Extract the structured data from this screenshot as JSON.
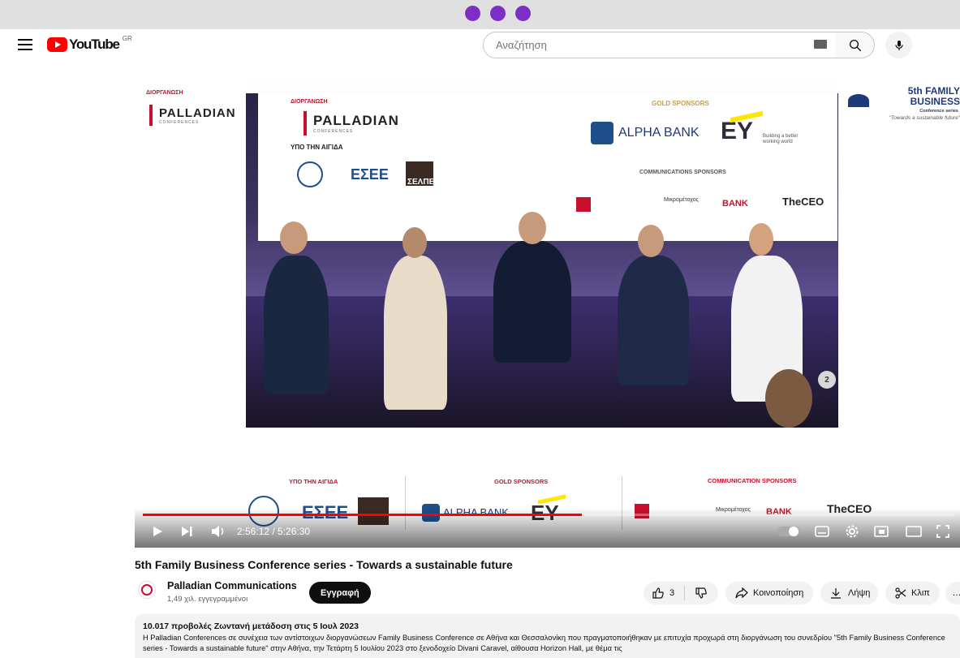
{
  "header": {
    "logo_text": "YouTube",
    "region": "GR",
    "search_placeholder": "Αναζήτηση"
  },
  "video": {
    "overlay": {
      "organizer_label": "ΔΙΟΡΓΑΝΩΣΗ",
      "organizer_brand": "PALLADIAN",
      "organizer_sub": "CONFERENCES",
      "auspices_label": "ΥΠΟ ΤΗΝ ΑΙΓΙΔΑ",
      "gold_label": "GOLD SPONSORS",
      "comm_label": "COMMUNICATIONS SPONSORS",
      "bottom_auspices": "ΥΠΟ ΤΗΝ ΑΙΓΙΔΑ",
      "bottom_gold": "GOLD SPONSORS",
      "bottom_comm": "COMMUNICATION SPONSORS",
      "alpha_bank": "ALPHA BANK",
      "ey": "EY",
      "ey_tag": "Building a better working world",
      "esee": "ΕΣΕΕ",
      "selpe": "ΣΕΛΠΕ",
      "bank": "BANK",
      "theceo": "TheCEO",
      "mikro": "Μικρομέτοχος",
      "event_brand": "5th FAMILY BUSINESS",
      "event_sub": "Conference series",
      "event_tag": "\"Towards a sustainable future\"",
      "stage_number": "2"
    },
    "time_display": "2:56:12 / 5:26:30",
    "progress": 0.5412
  },
  "title": "5th Family Business Conference series - Towards a sustainable future",
  "channel": {
    "name": "Palladian Communications",
    "subscribers": "1,49 χιλ. εγγεγραμμένοι",
    "subscribe_label": "Εγγραφή"
  },
  "actions": {
    "likes": "3",
    "share": "Κοινοποίηση",
    "download": "Λήψη",
    "clip": "Κλιπ",
    "more": "…"
  },
  "description": {
    "head": "10.017 προβολές  Ζωντανή μετάδοση στις 5 Ιουλ 2023",
    "body": "Η Palladian Conferences σε συνέχεια των αντίστοιχων διοργανώσεων Family Business Conference σε Αθήνα και Θεσσαλονίκη που πραγματοποιήθηκαν με επιτυχία προχωρά στη διοργάνωση του συνεδρίου \"5th Family Business Conference series - Towards a sustainable future\" στην Αθήνα, την Τετάρτη 5 Ιουλίου 2023 στο ξενοδοχείο Divani Caravel, αίθουσα Horizon Hall, με θέμα τις"
  },
  "colors": {
    "accent_red": "#ff0000",
    "top_dots": "#7b2fc4",
    "palladian_red": "#c8102e",
    "ey_yellow": "#ffe600"
  }
}
